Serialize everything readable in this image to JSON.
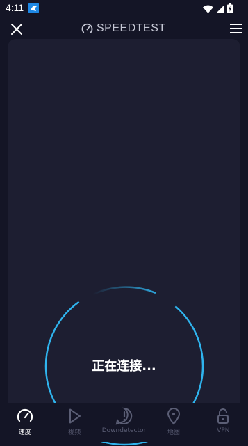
{
  "status_bar": {
    "time": "4:11"
  },
  "header": {
    "logo_text": "SPEEDTEST"
  },
  "test": {
    "status_text": "正在连接..."
  },
  "tabs": [
    {
      "label": "速度",
      "icon": "speed-gauge-icon",
      "active": true
    },
    {
      "label": "视频",
      "icon": "play-icon",
      "active": false
    },
    {
      "label": "Downdetector",
      "icon": "alert-icon",
      "active": false
    },
    {
      "label": "地图",
      "icon": "map-pin-icon",
      "active": false
    },
    {
      "label": "VPN",
      "icon": "lock-icon",
      "active": false
    }
  ],
  "colors": {
    "accent": "#2fb4ee",
    "background": "#141526",
    "card": "#1d1e31",
    "inactive": "#5b5e75"
  }
}
